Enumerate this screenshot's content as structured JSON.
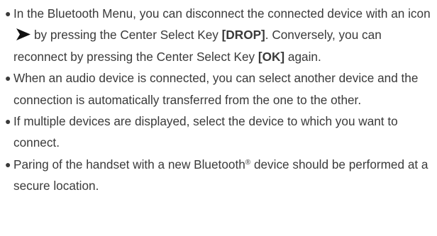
{
  "notes": [
    {
      "parts": [
        "In the Bluetooth Menu, you can disconnect the connected device with an icon",
        "by pressing the Center Select Key",
        "[DROP]",
        ". Conversely, you can reconnect by pressing the Center Select Key",
        "[OK]",
        "again."
      ]
    },
    {
      "text": "When an audio device is connected, you can select another device and the connection is automatically transferred from the one to the other."
    },
    {
      "text": "If multiple devices are displayed, select the device to which you want to connect."
    },
    {
      "parts": [
        "Paring of the handset with a new Bluetooth",
        "®",
        "device should be performed at a secure location."
      ]
    }
  ],
  "icons": {
    "connected_arrow": "connected-arrow-icon"
  },
  "colors": {
    "text": "#3a3a3a",
    "icon": "#111111"
  }
}
